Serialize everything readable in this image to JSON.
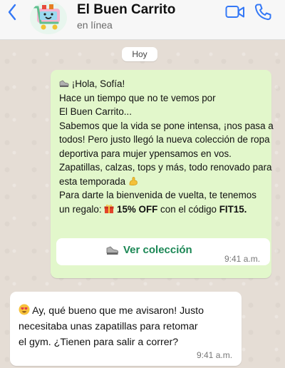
{
  "header": {
    "title": "El Buen Carrito",
    "status": "en línea"
  },
  "chat": {
    "day_label": "Hoy",
    "outgoing": {
      "lines": [
        {
          "prefix_icon": "sneaker-emoji",
          "text": "¡Hola, Sofía!"
        },
        {
          "text": "Hace un tiempo que no te vemos por"
        },
        {
          "text": "El Buen Carrito..."
        },
        {
          "text": "Sabemos que la vida se pone intensa, ¡nos pasa a"
        },
        {
          "text": "todos! Pero justo llegó la nueva colección de ropa"
        },
        {
          "text": "deportiva para mujer ypensamos en vos."
        },
        {
          "text": "Zapatillas, calzas, tops y más, todo renovado para"
        },
        {
          "text": "esta temporada",
          "suffix_icon": "flexed-biceps-emoji"
        },
        {
          "text": "Para darte la bienvenida de vuelta, te tenemos"
        }
      ],
      "offer": {
        "before": "un regalo: ",
        "gift_icon": "gift-emoji",
        "discount": "15% OFF",
        "middle": " con el código ",
        "code": "FIT15."
      },
      "cta_label": "Ver colección",
      "cta_icon": "sneaker-emoji",
      "time": "9:41 a.m."
    },
    "incoming": {
      "icon": "heart-eyes-emoji",
      "lines": [
        "Ay, qué bueno que me avisaron! Justo",
        "necesitaba unas zapatillas para retomar",
        "el gym. ¿Tienen para salir a correr?"
      ],
      "time": "9:41 a.m."
    }
  },
  "colors": {
    "accent": "#3478F6",
    "cta_green": "#1B8755",
    "bubble_out": "#E2F7CB",
    "bubble_in": "#FFFFFF"
  }
}
